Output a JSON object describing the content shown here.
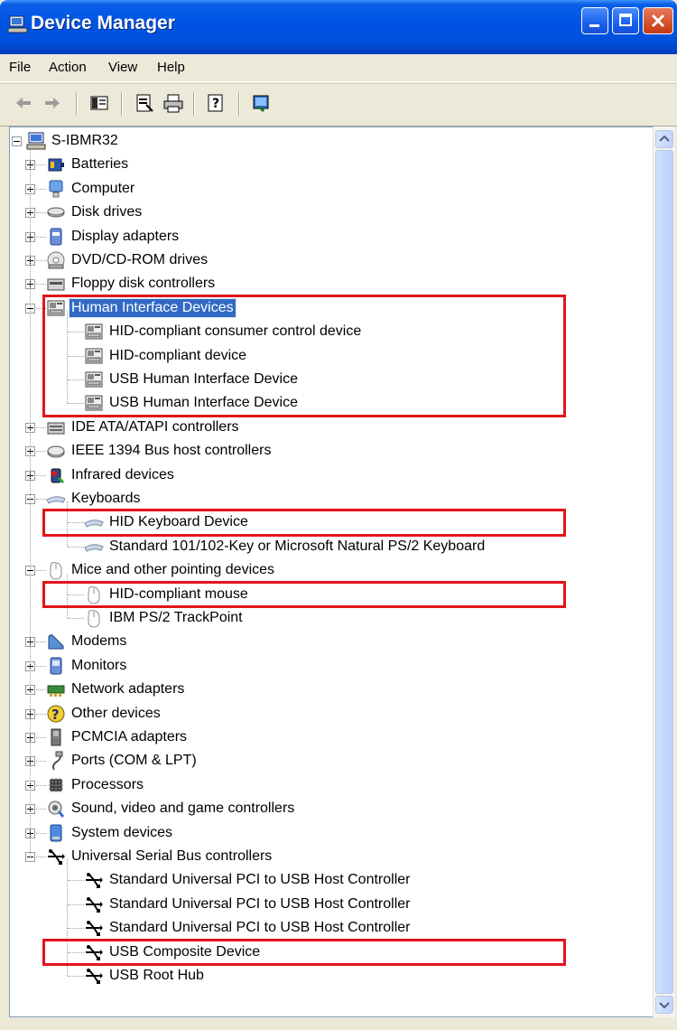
{
  "window": {
    "title": "Device Manager"
  },
  "menu": [
    "File",
    "Action",
    "View",
    "Help"
  ],
  "toolbar": [
    "back-icon",
    "forward-icon",
    "show-hide-console-tree-icon",
    "properties-icon",
    "print-icon",
    "help-icon",
    "scan-hardware-icon"
  ],
  "tree": {
    "root": "S-IBMR32",
    "categories": [
      {
        "label": "Batteries",
        "icon": "battery-icon",
        "expanded": false
      },
      {
        "label": "Computer",
        "icon": "computer-icon",
        "expanded": false
      },
      {
        "label": "Disk drives",
        "icon": "disk-drive-icon",
        "expanded": false
      },
      {
        "label": "Display adapters",
        "icon": "display-adapter-icon",
        "expanded": false
      },
      {
        "label": "DVD/CD-ROM drives",
        "icon": "cdrom-icon",
        "expanded": false
      },
      {
        "label": "Floppy disk controllers",
        "icon": "floppy-controller-icon",
        "expanded": false
      },
      {
        "label": "Human Interface Devices",
        "icon": "hid-icon",
        "expanded": true,
        "selected": true,
        "children": [
          "HID-compliant consumer control device",
          "HID-compliant device",
          "USB Human Interface Device",
          "USB Human Interface Device"
        ]
      },
      {
        "label": "IDE ATA/ATAPI controllers",
        "icon": "ide-controller-icon",
        "expanded": false
      },
      {
        "label": "IEEE 1394 Bus host controllers",
        "icon": "ieee1394-icon",
        "expanded": false
      },
      {
        "label": "Infrared devices",
        "icon": "infrared-icon",
        "expanded": false
      },
      {
        "label": "Keyboards",
        "icon": "keyboard-icon",
        "expanded": true,
        "children": [
          "HID Keyboard Device",
          "Standard 101/102-Key or Microsoft Natural PS/2 Keyboard"
        ]
      },
      {
        "label": "Mice and other pointing devices",
        "icon": "mouse-icon",
        "expanded": true,
        "children": [
          "HID-compliant mouse",
          "IBM PS/2 TrackPoint"
        ]
      },
      {
        "label": "Modems",
        "icon": "modem-icon",
        "expanded": false
      },
      {
        "label": "Monitors",
        "icon": "monitor-icon",
        "expanded": false
      },
      {
        "label": "Network adapters",
        "icon": "network-adapter-icon",
        "expanded": false
      },
      {
        "label": "Other devices",
        "icon": "unknown-device-icon",
        "expanded": false
      },
      {
        "label": "PCMCIA adapters",
        "icon": "pcmcia-icon",
        "expanded": false
      },
      {
        "label": "Ports (COM & LPT)",
        "icon": "port-icon",
        "expanded": false
      },
      {
        "label": "Processors",
        "icon": "processor-icon",
        "expanded": false
      },
      {
        "label": "Sound, video and game controllers",
        "icon": "sound-icon",
        "expanded": false
      },
      {
        "label": "System devices",
        "icon": "system-device-icon",
        "expanded": false
      },
      {
        "label": "Universal Serial Bus controllers",
        "icon": "usb-icon",
        "expanded": true,
        "children": [
          "Standard Universal PCI to USB Host Controller",
          "Standard Universal PCI to USB Host Controller",
          "Standard Universal PCI to USB Host Controller",
          "USB Composite Device",
          "USB Root Hub"
        ]
      }
    ]
  },
  "highlighted": [
    "Human Interface Devices",
    "HID Keyboard Device",
    "HID-compliant mouse",
    "USB Composite Device"
  ],
  "colors": {
    "highlight_box": "#e3141b",
    "selection": "#316ac5",
    "titlebar": "#0055e5"
  }
}
